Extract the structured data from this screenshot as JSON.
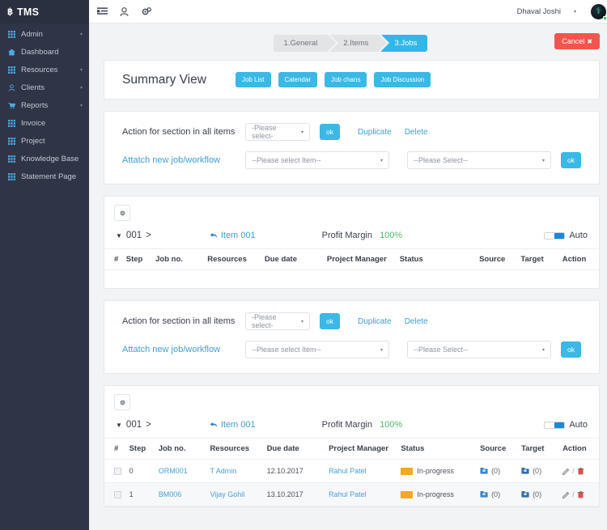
{
  "brand": {
    "mark": "฿",
    "name": "TMS"
  },
  "sidebar": {
    "items": [
      {
        "label": "Admin",
        "icon": "grid-icon",
        "caret": "▾"
      },
      {
        "label": "Dashboard",
        "icon": "home-icon",
        "caret": ""
      },
      {
        "label": "Resources",
        "icon": "grid-icon",
        "caret": "▾"
      },
      {
        "label": "Clients",
        "icon": "user-icon",
        "caret": "▾"
      },
      {
        "label": "Reports",
        "icon": "cart-icon",
        "caret": "▾"
      },
      {
        "label": "Invoice",
        "icon": "grid-icon",
        "caret": ""
      },
      {
        "label": "Project",
        "icon": "grid-icon",
        "caret": ""
      },
      {
        "label": "Knowledge Base",
        "icon": "grid-icon",
        "caret": ""
      },
      {
        "label": "Statement Page",
        "icon": "grid-icon",
        "caret": ""
      }
    ]
  },
  "topbar": {
    "icons": [
      "list-toggle-icon",
      "user-icon",
      "gear-icon"
    ],
    "user_name": "Dhaval Joshi",
    "user_caret": "▾"
  },
  "steps": {
    "items": [
      {
        "label": "1.General",
        "active": false
      },
      {
        "label": "2.Items",
        "active": false
      },
      {
        "label": "3.Jobs",
        "active": true
      }
    ],
    "cancel_label": "Cancel",
    "cancel_x": "✖"
  },
  "summary": {
    "title": "Summary View",
    "buttons": [
      "Job List",
      "Calendar",
      "Job chans",
      "Job Discussion"
    ]
  },
  "action_panel": {
    "row1_label": "Action for section in all items",
    "row1_select": "-Please select-",
    "ok_label": "ok",
    "duplicate_label": "Duplicate",
    "delete_label": "Delete",
    "row2_label": "Attatch new job/workflow",
    "row2_select_item": "--Please select Item--",
    "row2_select_wf": "--Please Select--",
    "caret": "▾"
  },
  "sections": [
    {
      "gear_icon": "gear-icon",
      "code": "001",
      "code_suffix": ">",
      "chevron": "❯",
      "item_label": "Item 001",
      "reply_icon": "reply-icon",
      "profit_label": "Profit Margin",
      "profit_value": "100%",
      "auto_label": "Auto",
      "columns": [
        "#",
        "Step",
        "Job no.",
        "Resources",
        "Due date",
        "Project Manager",
        "Status",
        "Source",
        "Target",
        "Action"
      ],
      "rows": []
    },
    {
      "gear_icon": "gear-icon",
      "code": "001",
      "code_suffix": ">",
      "chevron": "❯",
      "item_label": "Item 001",
      "reply_icon": "reply-icon",
      "profit_label": "Profit Margin",
      "profit_value": "100%",
      "auto_label": "Auto",
      "columns": [
        "#",
        "Step",
        "Job no.",
        "Resources",
        "Due date",
        "Project Manager",
        "Status",
        "Source",
        "Target",
        "Action"
      ],
      "rows": [
        {
          "step": "0",
          "job_no": "ORM001",
          "resources": "T Admin",
          "due_date": "12.10.2017",
          "project_manager": "Rahul Patel",
          "status": "In-progress",
          "source_count": "(0)",
          "target_count": "(0)",
          "action_sep": "/"
        },
        {
          "step": "1",
          "job_no": "BM006",
          "resources": "Vijay Gohil",
          "due_date": "13.10.2017",
          "project_manager": "Rahul Patel",
          "status": "In-progress",
          "source_count": "(0)",
          "target_count": "(0)",
          "action_sep": "/"
        }
      ]
    }
  ],
  "colors": {
    "sidebar": "#2f3446",
    "accent_blue": "#3bb8e5",
    "link_blue": "#3f9fd4",
    "danger_red": "#f2554e",
    "status_orange": "#f5a623",
    "profit_green": "#4cbb6b",
    "page_bg": "#f2f3f5"
  }
}
